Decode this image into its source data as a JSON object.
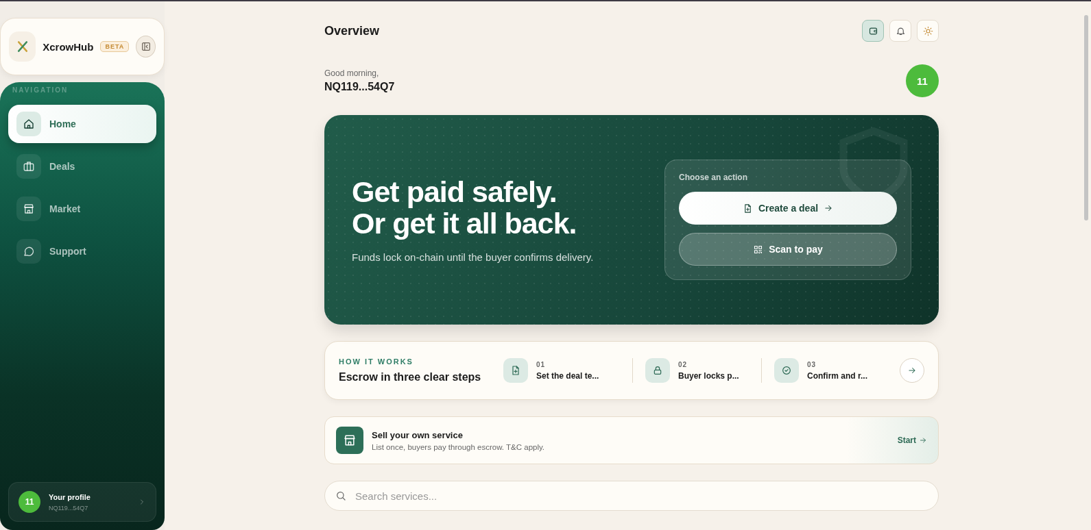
{
  "brand": {
    "name": "XcrowHub",
    "badge": "BETA"
  },
  "navigation": {
    "heading": "NAVIGATION",
    "items": [
      {
        "label": "Home",
        "selected": true
      },
      {
        "label": "Deals",
        "selected": false
      },
      {
        "label": "Market",
        "selected": false
      },
      {
        "label": "Support",
        "selected": false
      }
    ]
  },
  "profile": {
    "avatar": "11",
    "title": "Your profile",
    "address": "NQ119...54Q7"
  },
  "header": {
    "title": "Overview",
    "actions": [
      {
        "active": true
      },
      {
        "active": false
      },
      {
        "active": false
      }
    ]
  },
  "greeting": {
    "text": "Good morning,",
    "address": "NQ119...54Q7",
    "avatar": "11"
  },
  "hero": {
    "headline": [
      "Get paid safely.",
      "Or get it all back."
    ],
    "subtitle": "Funds lock on-chain until the buyer confirms delivery.",
    "panel_title": "Choose an action",
    "buttons": [
      {
        "label": "Create a deal",
        "kind": "primary"
      },
      {
        "label": "Scan to pay",
        "kind": "secondary"
      }
    ]
  },
  "how_it_works": {
    "eyebrow": "HOW IT WORKS",
    "title": "Escrow in three clear steps",
    "steps": [
      {
        "number": "01",
        "label": "Set the deal te..."
      },
      {
        "number": "02",
        "label": "Buyer locks p..."
      },
      {
        "number": "03",
        "label": "Confirm and r..."
      }
    ]
  },
  "sell": {
    "title": "Sell your own service",
    "subtitle": "List once, buyers pay through escrow. T&C apply.",
    "action": "Start"
  },
  "search": {
    "placeholder": "Search services..."
  }
}
